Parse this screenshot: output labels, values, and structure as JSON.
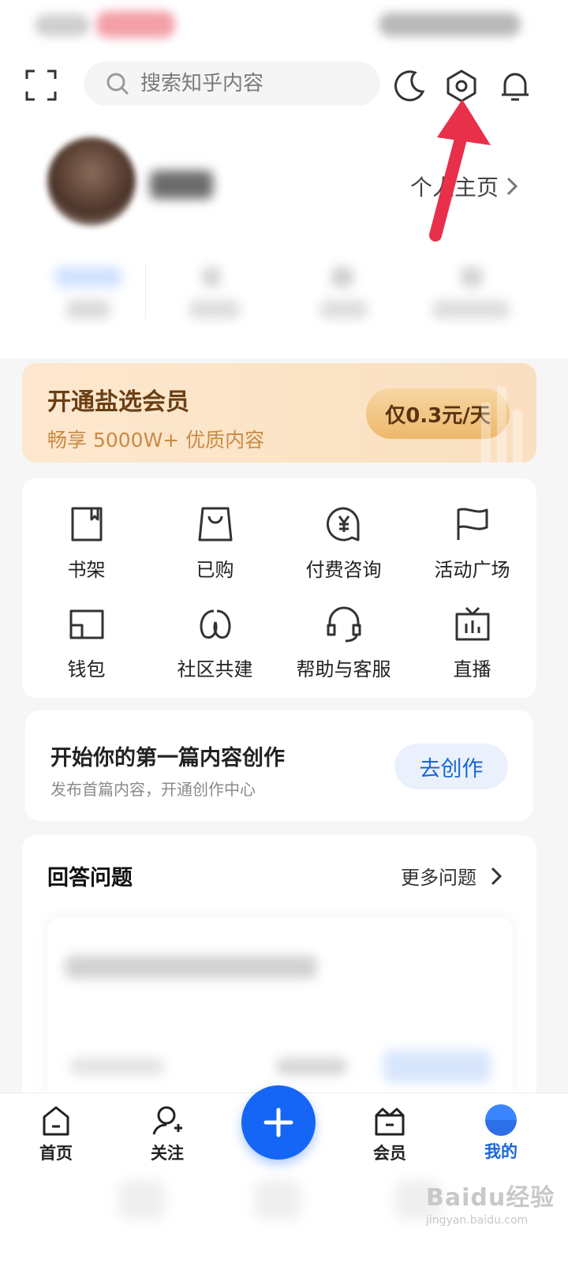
{
  "header": {
    "search_placeholder": "搜索知乎内容",
    "icons": [
      "scan-icon",
      "night-mode-icon",
      "settings-icon",
      "notification-bell-icon"
    ]
  },
  "profile": {
    "homepage_label": "个人主页"
  },
  "vip": {
    "title": "开通盐选会员",
    "subtitle": "畅享 5000W+ 优质内容",
    "button": "仅0.3元/天"
  },
  "features": [
    {
      "label": "书架",
      "icon": "bookshelf-icon"
    },
    {
      "label": "已购",
      "icon": "purchased-bag-icon"
    },
    {
      "label": "付费咨询",
      "icon": "paid-consult-icon"
    },
    {
      "label": "活动广场",
      "icon": "flag-icon"
    },
    {
      "label": "钱包",
      "icon": "wallet-icon"
    },
    {
      "label": "社区共建",
      "icon": "community-icon"
    },
    {
      "label": "帮助与客服",
      "icon": "headset-icon"
    },
    {
      "label": "直播",
      "icon": "live-tv-icon"
    }
  ],
  "create": {
    "title": "开始你的第一篇内容创作",
    "subtitle": "发布首篇内容，开通创作中心",
    "button": "去创作"
  },
  "answer": {
    "title": "回答问题",
    "more": "更多问题"
  },
  "nav": {
    "items": [
      {
        "label": "首页",
        "icon": "home-icon"
      },
      {
        "label": "关注",
        "icon": "follow-icon"
      },
      {
        "label": "会员",
        "icon": "vip-icon"
      },
      {
        "label": "我的",
        "icon": "me-avatar-icon",
        "active": true
      }
    ],
    "fab_icon": "plus-icon"
  },
  "colors": {
    "accent_blue": "#1566f5",
    "vip_text": "#6a3f14",
    "vip_gold": "#c98a44",
    "arrow_red": "#e8304a"
  },
  "watermark": {
    "main": "Baidu经验",
    "sub": "jingyan.baidu.com"
  }
}
